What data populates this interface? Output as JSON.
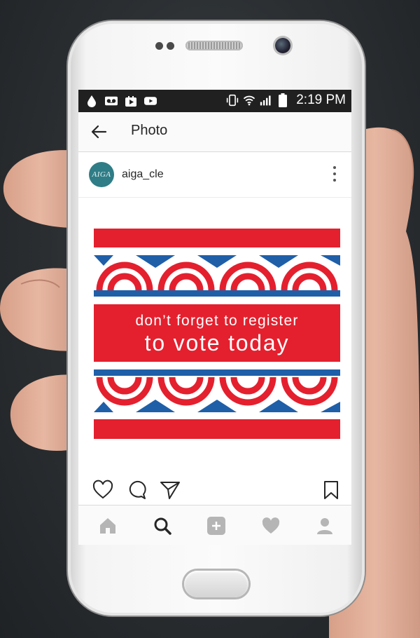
{
  "status_bar": {
    "time": "2:19 PM",
    "notification_icons": [
      "drop-icon",
      "voicemail-icon",
      "play-store-icon",
      "youtube-icon"
    ],
    "system_icons": [
      "vibrate-icon",
      "wifi-icon",
      "signal-icon",
      "battery-icon"
    ]
  },
  "top_bar": {
    "title": "Photo"
  },
  "post": {
    "username": "aiga_cle",
    "avatar_text": "AIGA",
    "image": {
      "line1": "don’t forget to register",
      "line2": "to vote today",
      "colors": {
        "red": "#e4202e",
        "blue": "#1f5fa8",
        "white": "#ffffff"
      }
    },
    "actions": [
      "like-icon",
      "comment-icon",
      "share-icon",
      "bookmark-icon"
    ]
  },
  "bottom_nav": {
    "items": [
      "home-icon",
      "search-icon",
      "add-icon",
      "activity-icon",
      "profile-icon"
    ],
    "active": "search-icon"
  },
  "colors": {
    "status_bar_bg": "#202020",
    "app_bg": "#fafafa",
    "text": "#262626",
    "avatar_bg": "#2f7d86"
  }
}
